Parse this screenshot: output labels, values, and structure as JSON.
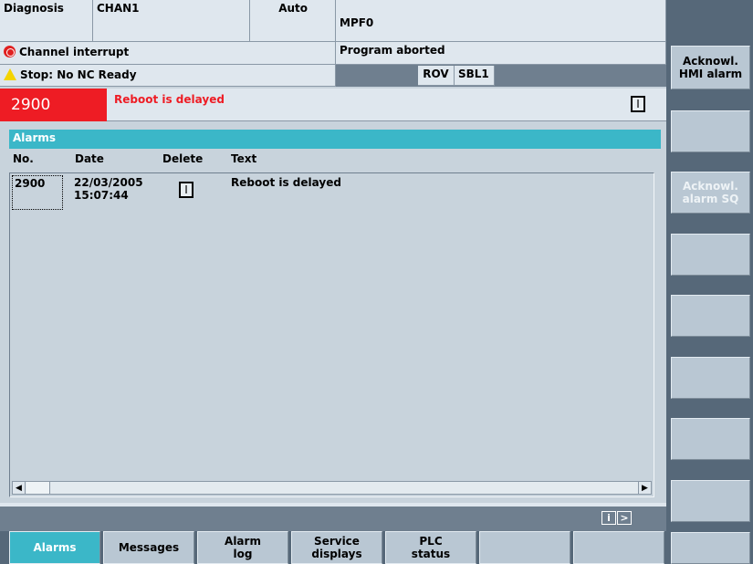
{
  "header": {
    "area": "Diagnosis",
    "channel": "CHAN1",
    "mode": "Auto",
    "program": "MPF0",
    "channel_status": "Channel interrupt",
    "program_status": "Program aborted",
    "stop_message": "Stop: No NC Ready",
    "flags": [
      "ROV",
      "SBL1"
    ],
    "alarm_number": "2900",
    "alarm_text": "Reboot is delayed",
    "alarm_key": "I"
  },
  "alarms": {
    "title": "Alarms",
    "columns": [
      "No.",
      "Date",
      "Delete",
      "Text"
    ],
    "rows": [
      {
        "no": "2900",
        "date": "22/03/2005",
        "time": "15:07:44",
        "delete_key": "I",
        "text": "Reboot is delayed"
      }
    ]
  },
  "status_icons": {
    "info": "i",
    "next": ">"
  },
  "softkeys": [
    {
      "label": "Acknowl.\nHMI alarm",
      "enabled": true
    },
    {
      "label": "",
      "enabled": true
    },
    {
      "label": "Acknowl.\nalarm SQ",
      "enabled": false
    },
    {
      "label": "",
      "enabled": true
    },
    {
      "label": "",
      "enabled": true
    },
    {
      "label": "",
      "enabled": true
    },
    {
      "label": "",
      "enabled": true
    },
    {
      "label": "",
      "enabled": true
    }
  ],
  "tabs": [
    {
      "label": "Alarms",
      "active": true
    },
    {
      "label": "Messages",
      "active": false
    },
    {
      "label": "Alarm\nlog",
      "active": false
    },
    {
      "label": "Service\ndisplays",
      "active": false
    },
    {
      "label": "PLC\nstatus",
      "active": false
    },
    {
      "label": "",
      "active": false
    },
    {
      "label": "",
      "active": false
    },
    {
      "label": "",
      "active": false
    }
  ],
  "colors": {
    "accent": "#3bb7c8",
    "alarm_red": "#ee1c24",
    "softkey_bg": "#b9c7d3",
    "frame": "#566879"
  }
}
